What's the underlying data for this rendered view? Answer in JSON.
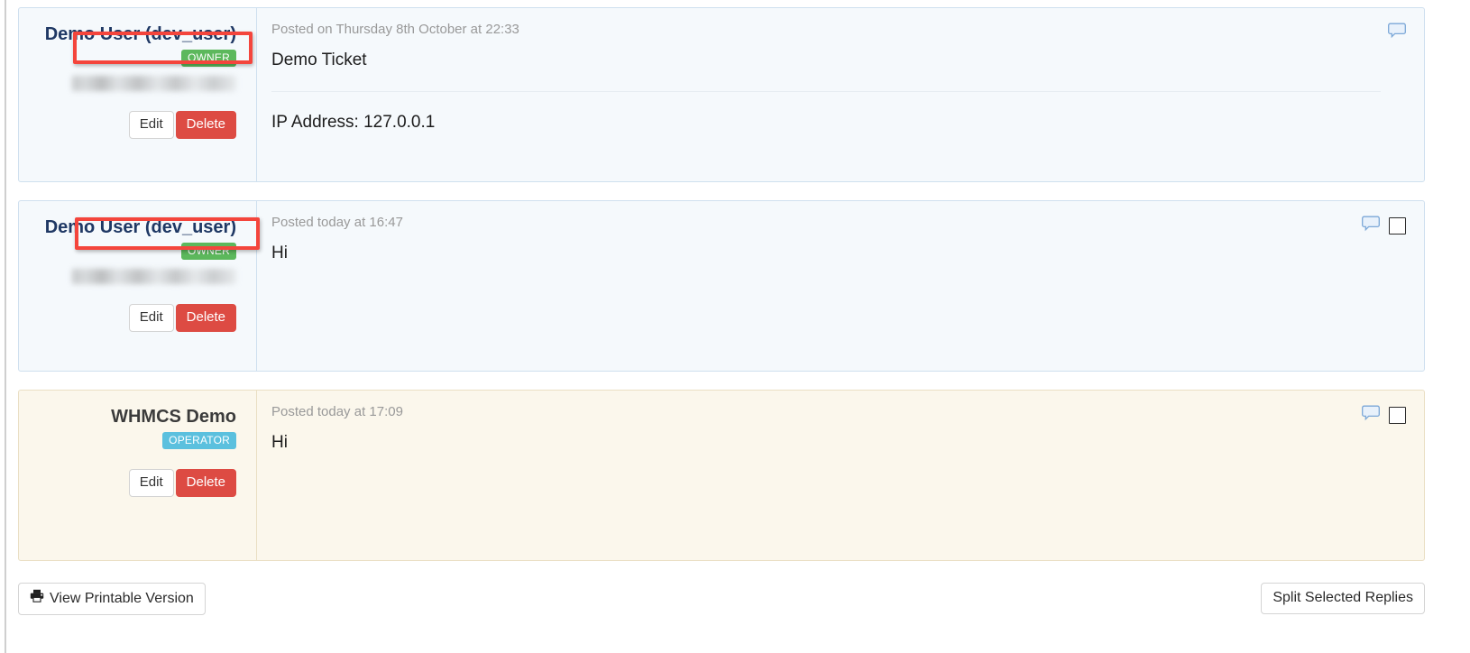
{
  "replies": [
    {
      "author": {
        "name": "Demo User (dev_user)",
        "badge": "OWNER",
        "badge_type": "owner",
        "email_redacted": "",
        "edit_label": "Edit",
        "delete_label": "Delete",
        "highlighted": true
      },
      "posted": "Posted on Thursday 8th October at 22:33",
      "title": "Demo Ticket",
      "has_divider": true,
      "ip_line": "IP Address: 127.0.0.1",
      "bubble_icon": "speech-bubble-icon",
      "has_checkbox": false,
      "checkbox_checked": false,
      "variant": "client"
    },
    {
      "author": {
        "name": "Demo User (dev_user)",
        "badge": "OWNER",
        "badge_type": "owner",
        "email_redacted": "",
        "edit_label": "Edit",
        "delete_label": "Delete",
        "highlighted": true
      },
      "posted": "Posted today at 16:47",
      "title": "Hi",
      "has_divider": false,
      "ip_line": "",
      "bubble_icon": "speech-bubble-icon",
      "has_checkbox": true,
      "checkbox_checked": false,
      "variant": "client"
    },
    {
      "author": {
        "name": "WHMCS Demo",
        "badge": "OPERATOR",
        "badge_type": "operator",
        "email_redacted": "",
        "edit_label": "Edit",
        "delete_label": "Delete",
        "highlighted": false
      },
      "posted": "Posted today at 17:09",
      "title": "Hi",
      "has_divider": false,
      "ip_line": "",
      "bubble_icon": "speech-bubble-icon",
      "has_checkbox": true,
      "checkbox_checked": false,
      "variant": "operator"
    }
  ],
  "footer": {
    "print_label": "View Printable Version",
    "print_icon": "printer-icon",
    "split_label": "Split Selected Replies"
  },
  "colors": {
    "owner_badge": "#5cb85c",
    "operator_badge": "#5bc0de",
    "delete_button": "#dd4b43",
    "highlight_box": "#f4453c",
    "client_panel_bg": "#f5f9fc",
    "client_panel_border": "#cfe0ef",
    "operator_panel_bg": "#fbf7ec",
    "operator_panel_border": "#eadfc4",
    "author_name": "#1f3864",
    "posted_text": "#999999"
  }
}
